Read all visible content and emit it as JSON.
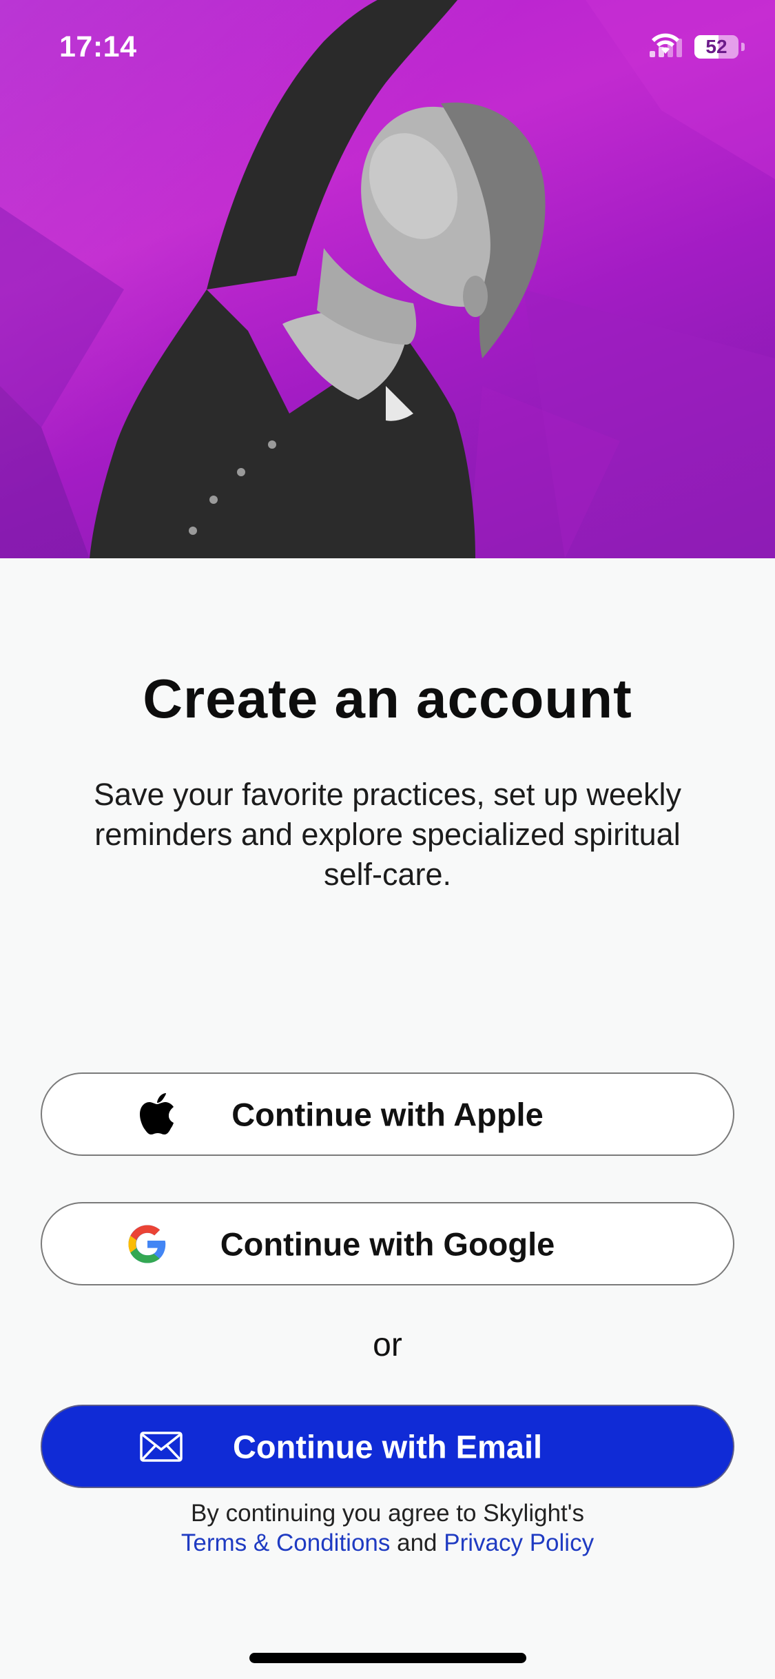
{
  "status_bar": {
    "time": "17:14",
    "battery_level": "52"
  },
  "hero": {
    "background_color": "#b424cf",
    "image": "woman-stretching-photo"
  },
  "content": {
    "title": "Create an account",
    "subtitle": "Save your favorite practices, set up weekly reminders and explore specialized spiritual self-care."
  },
  "buttons": {
    "apple": {
      "label": "Continue with Apple",
      "icon": "apple-logo-icon"
    },
    "google": {
      "label": "Continue with Google",
      "icon": "google-logo-icon"
    },
    "email": {
      "label": "Continue with Email",
      "icon": "envelope-icon",
      "color": "#102bd6"
    }
  },
  "divider_text": "or",
  "legal": {
    "prefix": "By continuing you agree to Skylight's",
    "terms_link": "Terms & Conditions",
    "conjunction": "and",
    "privacy_link": "Privacy Policy",
    "link_color": "#1f3bc2"
  }
}
